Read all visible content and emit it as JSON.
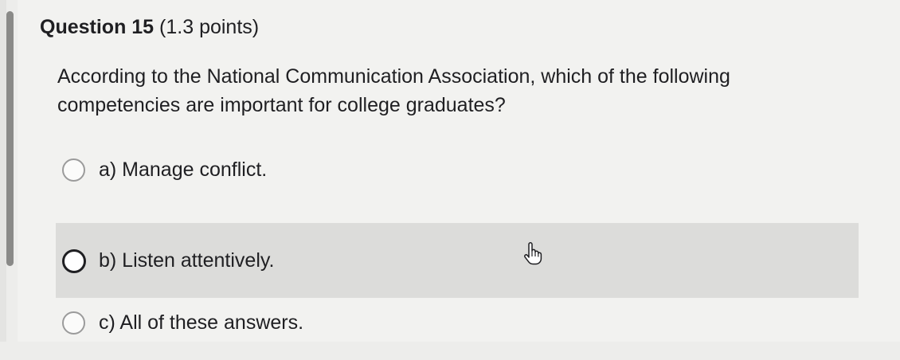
{
  "question": {
    "title": "Question 15",
    "points": "(1.3 points)",
    "text": "According to the National Communication Association, which of the following competencies are important for college graduates?"
  },
  "answers": [
    {
      "label": "a) Manage conflict.",
      "state": "default"
    },
    {
      "label": "b) Listen attentively.",
      "state": "hover"
    },
    {
      "label": "c) All of these answers.",
      "state": "default"
    }
  ],
  "cursor": {
    "icon": "hand-pointer-icon"
  },
  "colors": {
    "hover_background": "#dcdcda",
    "page_background": "#f2f2f0"
  }
}
